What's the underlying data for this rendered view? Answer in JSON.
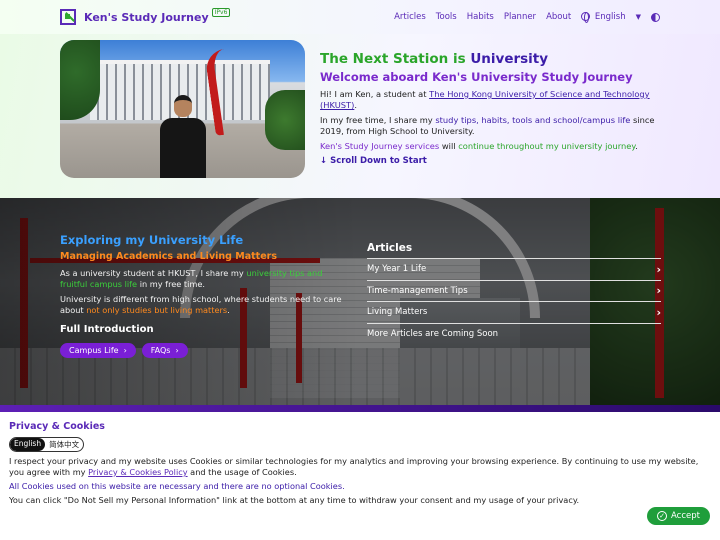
{
  "nav": {
    "brand": "Ken's Study Journey",
    "badge": "IPv6",
    "items": [
      "Articles",
      "Tools",
      "Habits",
      "Planner",
      "About"
    ],
    "language": "English"
  },
  "hero": {
    "title_prefix": "The Next Station is ",
    "title_highlight": "University",
    "subtitle": "Welcome aboard Ken's University Study Journey",
    "p1_pre": "Hi! I am Ken, a student at ",
    "p1_link": "The Hong Kong University of Science and Technology (HKUST)",
    "p1_post": ".",
    "p2_pre": "In my free time, I share my ",
    "p2_highlight": "study tips, habits, tools and school/campus life",
    "p2_post": " since 2019, from High School to University.",
    "p3_a": "Ken's Study Journey services",
    "p3_b": " will ",
    "p3_c": "continue throughout my university journey",
    "p3_d": ".",
    "scroll": "↓ Scroll Down to Start"
  },
  "banner": {
    "heading": "Exploring my University Life",
    "subheading": "Managing Academics and Living Matters",
    "p1_pre": "As a university student at HKUST, I share my ",
    "p1_highlight": "university tips and fruitful campus life",
    "p1_post": " in my free time.",
    "p2_pre": "University is different from high school, where students need to care about ",
    "p2_highlight": "not only studies but living matters",
    "p2_post": ".",
    "full_intro": "Full Introduction",
    "buttons": [
      "Campus Life",
      "FAQs"
    ]
  },
  "articles": {
    "title": "Articles",
    "items": [
      "My Year 1 Life",
      "Time-management Tips",
      "Living Matters",
      "More Articles are Coming Soon"
    ]
  },
  "cookie": {
    "title": "Privacy & Cookies",
    "lang_en": "English",
    "lang_zh": "简体中文",
    "p1_pre": "I respect your privacy and my website uses Cookies or similar technologies for my analytics and improving your browsing experience. By continuing to use my website, you agree with my ",
    "p1_link": "Privacy & Cookies Policy",
    "p1_post": " and the usage of Cookies.",
    "p2": "All Cookies used on this website are necessary and there are no optional Cookies.",
    "p3": "You can click \"Do Not Sell my Personal Information\" link at the bottom at any time to withdraw your consent and my usage of your privacy.",
    "accept": "Accept"
  }
}
